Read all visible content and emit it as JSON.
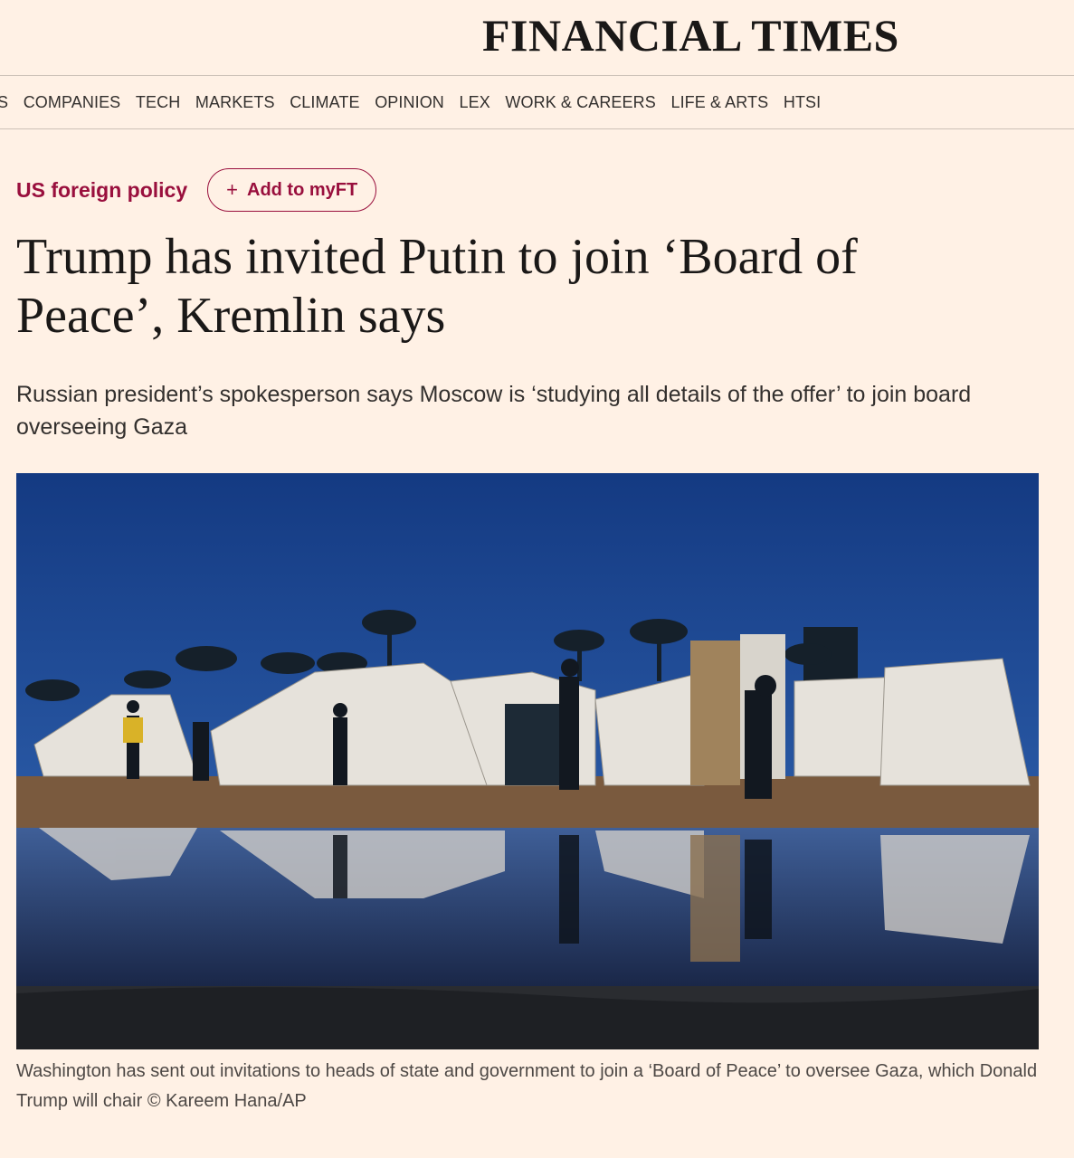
{
  "masthead": {
    "logo_text": "FINANCIAL TIMES"
  },
  "nav": {
    "items": [
      "S",
      "COMPANIES",
      "TECH",
      "MARKETS",
      "CLIMATE",
      "OPINION",
      "LEX",
      "WORK & CAREERS",
      "LIFE & ARTS",
      "HTSI"
    ]
  },
  "article": {
    "topic": "US foreign policy",
    "add_to_myft": "Add to myFT",
    "headline": "Trump has invited Putin to join ‘Board of Peace’, Kremlin says",
    "standfirst": "Russian president’s spokesperson says Moscow is ‘studying all details of the offer’ to join board overseeing Gaza",
    "image_caption": "Washington has sent out invitations to heads of state and government to join a ‘Board of Peace’ to oversee Gaza, which Donald Trump will chair © Kareem Hana/AP"
  },
  "colors": {
    "background": "#fff1e5",
    "accent": "#990f3d",
    "text": "#33302e"
  }
}
